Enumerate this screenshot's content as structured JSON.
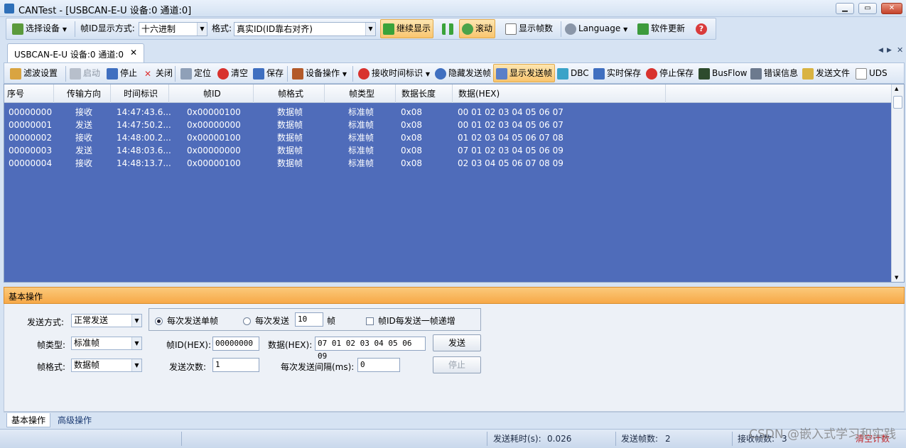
{
  "window": {
    "title": "CANTest  - [USBCAN-E-U 设备:0 通道:0]",
    "minimize": "▁",
    "restore": "▭",
    "close": "✕"
  },
  "toolbar1": {
    "select_device": "选择设备",
    "frame_id_display_label": "帧ID显示方式:",
    "frame_id_display_value": "十六进制",
    "format_label": "格式:",
    "format_value": "真实ID(ID靠右对齐)",
    "continue_display": "继续显示",
    "scroll": "滚动",
    "show_frame_count": "显示帧数",
    "language": "Language",
    "software_update": "软件更新"
  },
  "doc_tab": {
    "label": "USBCAN-E-U 设备:0 通道:0",
    "close": "✕"
  },
  "toolbar2": {
    "filter_settings": "滤波设置",
    "start": "启动",
    "stop": "停止",
    "close": "关闭",
    "locate": "定位",
    "clear": "清空",
    "save": "保存",
    "device_ops": "设备操作",
    "rx_time_mark": "接收时间标识",
    "hide_tx_frames": "隐藏发送帧",
    "show_tx_frames": "显示发送帧",
    "dbc": "DBC",
    "realtime_save": "实时保存",
    "stop_save": "停止保存",
    "busflow": "BusFlow",
    "error_info": "错误信息",
    "send_file": "发送文件",
    "uds": "UDS"
  },
  "grid": {
    "columns": [
      "序号",
      "传输方向",
      "时间标识",
      "帧ID",
      "帧格式",
      "帧类型",
      "数据长度",
      "数据(HEX)"
    ],
    "rows": [
      [
        "00000000",
        "接收",
        "14:47:43.6...",
        "0x00000100",
        "数据帧",
        "标准帧",
        "0x08",
        "00 01 02 03 04 05 06 07"
      ],
      [
        "00000001",
        "发送",
        "14:47:50.2...",
        "0x00000000",
        "数据帧",
        "标准帧",
        "0x08",
        "00 01 02 03 04 05 06 07"
      ],
      [
        "00000002",
        "接收",
        "14:48:00.2...",
        "0x00000100",
        "数据帧",
        "标准帧",
        "0x08",
        "01 02 03 04 05 06 07 08"
      ],
      [
        "00000003",
        "发送",
        "14:48:03.6...",
        "0x00000000",
        "数据帧",
        "标准帧",
        "0x08",
        "07 01 02 03 04 05 06 09"
      ],
      [
        "00000004",
        "接收",
        "14:48:13.7...",
        "0x00000100",
        "数据帧",
        "标准帧",
        "0x08",
        "02 03 04 05 06 07 08 09"
      ]
    ]
  },
  "basic_ops": {
    "header": "基本操作",
    "send_mode_label": "发送方式:",
    "send_mode_value": "正常发送",
    "single_frame": "每次发送单帧",
    "multi_frame_label": "每次发送",
    "multi_frame_count": "10",
    "frame_unit": "帧",
    "id_increment": "帧ID每发送一帧递增",
    "frame_type_label": "帧类型:",
    "frame_type_value": "标准帧",
    "frame_id_label": "帧ID(HEX):",
    "frame_id_value": "00000000",
    "data_label": "数据(HEX):",
    "data_value": "07 01 02 03 04 05 06 09",
    "send_button": "发送",
    "frame_format_label": "帧格式:",
    "frame_format_value": "数据帧",
    "send_count_label": "发送次数:",
    "send_count_value": "1",
    "interval_label": "每次发送间隔(ms):",
    "interval_value": "0",
    "stop_button": "停止"
  },
  "bottom_tabs": {
    "basic": "基本操作",
    "advanced": "高级操作"
  },
  "status": {
    "send_time_label": "发送耗时(s):",
    "send_time_value": "0.026",
    "send_frames_label": "发送帧数:",
    "send_frames_value": "2",
    "recv_frames_label": "接收帧数:",
    "recv_frames_value": "3",
    "clear_count": "清空计数"
  },
  "watermark": "CSDN @嵌入式学习和实践",
  "colors": {
    "grid_bg": "#4f6cba",
    "highlight": "#f9c56e",
    "panel_header": "#f7a948"
  }
}
